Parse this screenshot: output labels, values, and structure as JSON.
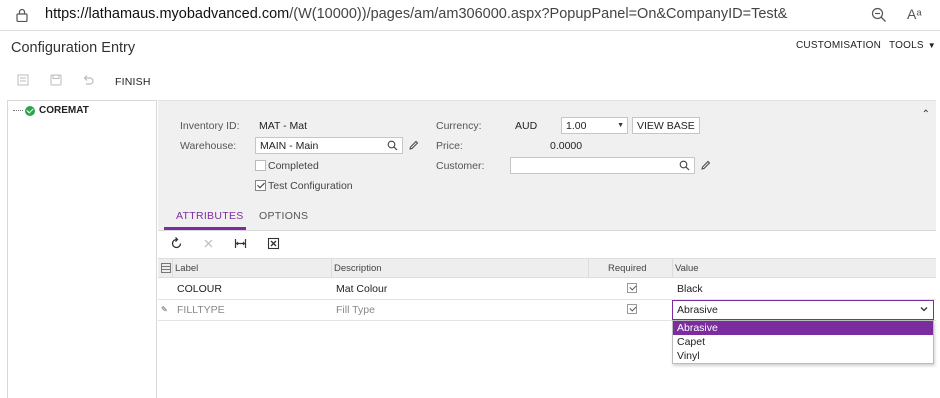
{
  "browser": {
    "url_host": "https://lathamaus.myobadvanced.com",
    "url_path": "/(W(10000))/pages/am/am306000.aspx?PopupPanel=On&CompanyID=Test&",
    "read_aloud": "Aᵃ"
  },
  "header": {
    "title": "Configuration Entry",
    "customisation": "CUSTOMISATION",
    "tools": "TOOLS"
  },
  "toolbar": {
    "finish": "FINISH"
  },
  "tree": {
    "root_label": "COREMAT"
  },
  "form": {
    "inventory_id_label": "Inventory ID:",
    "inventory_id_value": "MAT - Mat",
    "warehouse_label": "Warehouse:",
    "warehouse_value": "MAIN - Main",
    "completed_label": "Completed",
    "completed_checked": false,
    "test_config_label": "Test Configuration",
    "test_config_checked": true,
    "currency_label": "Currency:",
    "currency_value": "AUD",
    "rate_value": "1.00",
    "view_base": "VIEW BASE",
    "price_label": "Price:",
    "price_value": "0.0000",
    "customer_label": "Customer:",
    "customer_value": ""
  },
  "tabs": [
    {
      "label": "ATTRIBUTES",
      "active": true
    },
    {
      "label": "OPTIONS",
      "active": false
    }
  ],
  "grid": {
    "columns": [
      "Label",
      "Description",
      "Required",
      "Value"
    ],
    "rows": [
      {
        "label": "COLOUR",
        "description": "Mat Colour",
        "required": true,
        "value": "Black"
      },
      {
        "label": "FILLTYPE",
        "description": "Fill Type",
        "required": true,
        "value": "Abrasive"
      }
    ]
  },
  "dropdown": {
    "selected": "Abrasive",
    "options": [
      "Abrasive",
      "Capet",
      "Vinyl"
    ]
  },
  "colors": {
    "accent": "#7b2d9f",
    "success": "#2ea44f"
  }
}
